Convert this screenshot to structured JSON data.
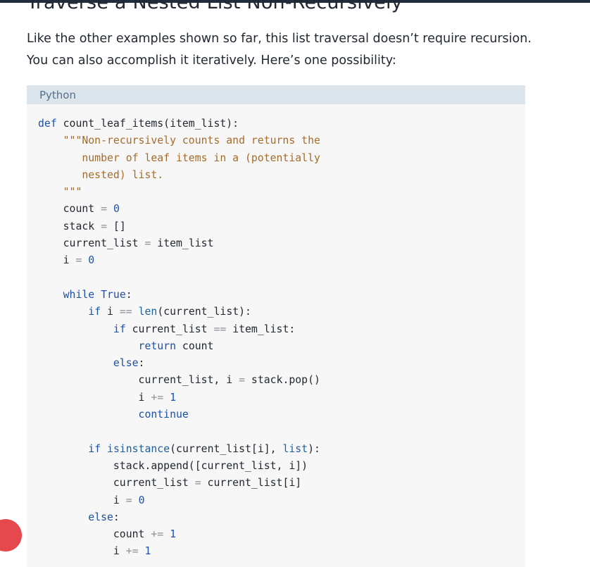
{
  "heading": "Traverse a Nested List Non-Recursively",
  "intro_line1": "Like the other examples shown so far, this list traversal doesn’t require recursion.",
  "intro_line2": "You can also accomplish it iteratively. Here’s one possibility:",
  "code_block": {
    "language_label": "Python",
    "lines": [
      "def count_leaf_items(item_list):",
      "    \"\"\"Non-recursively counts and returns the",
      "       number of leaf items in a (potentially",
      "       nested) list.",
      "    \"\"\"",
      "    count = 0",
      "    stack = []",
      "    current_list = item_list",
      "    i = 0",
      "",
      "    while True:",
      "        if i == len(current_list):",
      "            if current_list == item_list:",
      "                return count",
      "            else:",
      "                current_list, i = stack.pop()",
      "                i += 1",
      "                continue",
      "",
      "        if isinstance(current_list[i], list):",
      "            stack.append([current_list, i])",
      "            current_list = current_list[i]",
      "            i = 0",
      "        else:",
      "            count += 1",
      "            i += 1"
    ]
  },
  "colors": {
    "keyword": "#1a50a8",
    "string": "#a46b2a",
    "builtin": "#1c5f9e",
    "operator": "#8a8f98",
    "number": "#1d52b3",
    "code_background": "#f7f7f7",
    "tab_background": "#dde5ec",
    "top_bar": "#1f2d3d",
    "floating_dot": "#e5484d"
  }
}
